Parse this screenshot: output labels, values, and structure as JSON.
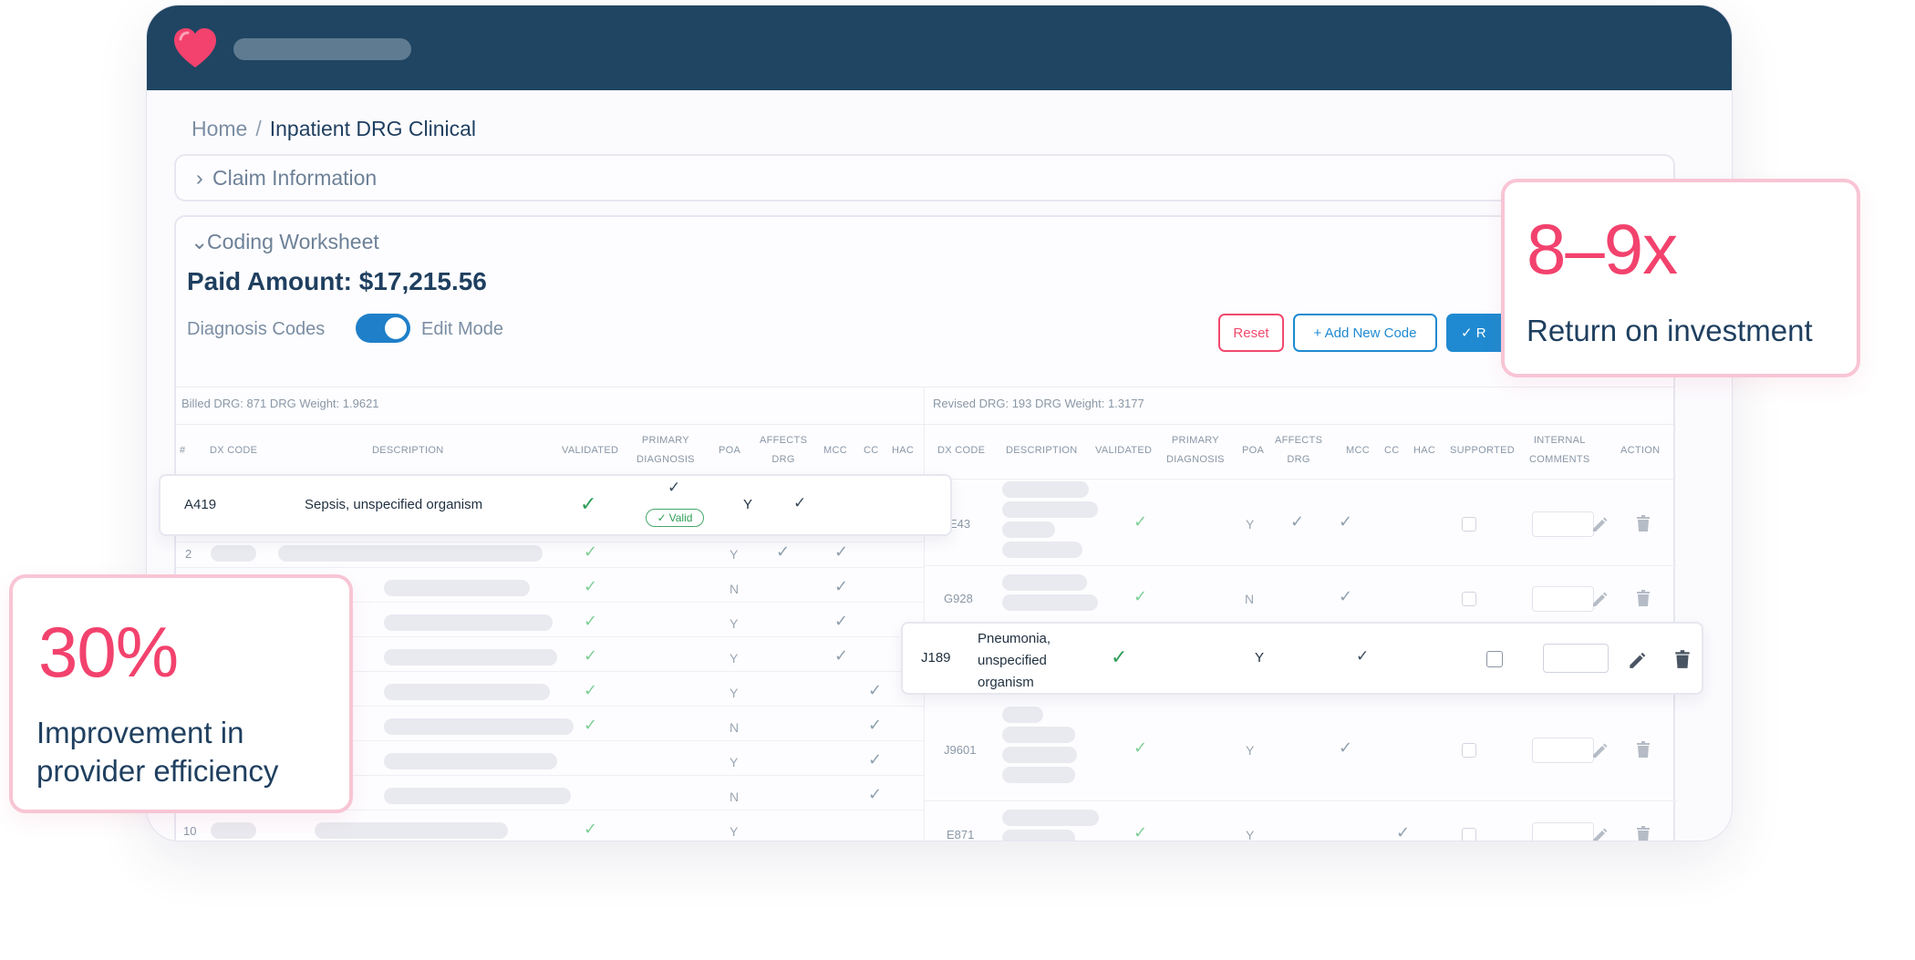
{
  "breadcrumb": {
    "home": "Home",
    "separator": "/",
    "current": "Inpatient DRG Clinical"
  },
  "claim_section": {
    "chevron": "›",
    "title": "Claim Information"
  },
  "coding_section": {
    "chevron": "⌄",
    "title": "Coding Worksheet",
    "paid_amount": "Paid Amount: $17,215.56",
    "diagnosis_codes_label": "Diagnosis Codes",
    "edit_mode_label": "Edit Mode",
    "edit_mode_on": true
  },
  "toolbar": {
    "reset": "Reset",
    "add_new_code": "+ Add New Code",
    "review": "✓ R"
  },
  "billed": {
    "info": "Billed DRG: 871    DRG Weight: 1.9621"
  },
  "revised": {
    "info": "Revised DRG: 193    DRG Weight: 1.3177"
  },
  "left_headers": {
    "num": "#",
    "dx_code": "DX CODE",
    "description": "DESCRIPTION",
    "validated": "VALIDATED",
    "primary_1": "PRIMARY",
    "primary_2": "DIAGNOSIS",
    "poa": "POA",
    "affects_1": "AFFECTS",
    "affects_2": "DRG",
    "mcc": "MCC",
    "cc": "CC",
    "hac": "HAC"
  },
  "right_headers": {
    "dx_code": "DX CODE",
    "description": "DESCRIPTION",
    "validated": "VALIDATED",
    "primary_1": "PRIMARY",
    "primary_2": "DIAGNOSIS",
    "poa": "POA",
    "affects_1": "AFFECTS",
    "affects_2": "DRG",
    "mcc": "MCC",
    "cc": "CC",
    "hac": "HAC",
    "supported": "SUPPORTED",
    "internal_1": "INTERNAL",
    "internal_2": "COMMENTS",
    "action": "ACTION"
  },
  "left_rows": [
    {
      "num": "2",
      "poa": "Y"
    },
    {
      "num": "",
      "poa": "N"
    },
    {
      "num": "",
      "poa": "Y"
    },
    {
      "num": "",
      "poa": "Y"
    },
    {
      "num": "",
      "poa": "Y"
    },
    {
      "num": "",
      "poa": "N"
    },
    {
      "num": "",
      "poa": "Y"
    },
    {
      "num": "",
      "poa": "N"
    },
    {
      "num": "10",
      "poa": "Y"
    }
  ],
  "right_rows": [
    {
      "code": "E43",
      "poa": "Y"
    },
    {
      "code": "G928",
      "poa": "N"
    },
    {
      "code": "J9601",
      "poa": "Y"
    },
    {
      "code": "E871",
      "poa": "Y"
    }
  ],
  "highlight_left": {
    "code": "A419",
    "description": "Sepsis, unspecified organism",
    "primary_check": "✓",
    "valid_badge": "Valid",
    "poa": "Y"
  },
  "highlight_right": {
    "code": "J189",
    "description_1": "Pneumonia,",
    "description_2": "unspecified",
    "description_3": "organism",
    "poa": "Y"
  },
  "stats": {
    "roi_value": "8–9x",
    "roi_label": "Return on investment",
    "eff_value": "30%",
    "eff_label_1": "Improvement in",
    "eff_label_2": "provider efficiency"
  },
  "colors": {
    "topbar": "#1f4562",
    "accent_pink": "#f2426d",
    "accent_blue": "#1f8ad1",
    "check_green": "#2e9e58"
  },
  "icons": [
    "heart-logo-icon",
    "chevron-right-icon",
    "chevron-down-icon",
    "check-icon",
    "pencil-icon",
    "trash-icon"
  ]
}
